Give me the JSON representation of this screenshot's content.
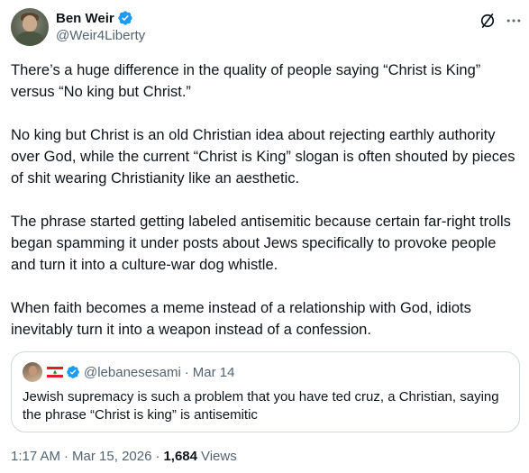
{
  "author": {
    "display_name": "Ben Weir",
    "handle": "@Weir4Liberty",
    "verified": true
  },
  "icons": {
    "verified": "verified-badge-icon",
    "grok": "grok-icon",
    "more": "more-options-icon",
    "flag": "lebanon-flag-icon"
  },
  "colors": {
    "verified_blue": "#1d9bf0",
    "secondary_text": "#536471",
    "border": "#cfd9de"
  },
  "tweet": {
    "paragraphs": [
      "There’s a huge difference in the quality of people saying “Christ is King” versus “No king but Christ.”",
      "No king but Christ is an old Christian idea about rejecting earthly authority over God, while the current “Christ is King” slogan is often shouted by pieces of shit wearing Christianity like an aesthetic.",
      "The phrase started getting labeled antisemitic because certain far-right trolls began spamming it under posts about Jews specifically to provoke people and turn it into a culture-war dog whistle.",
      "When faith becomes a meme instead of a relationship with God, idiots inevitably turn it into a weapon instead of a confession."
    ]
  },
  "quote": {
    "handle": "@lebanesesami",
    "separator": "·",
    "date": "Mar 14",
    "text": "Jewish supremacy is such a problem that you have ted cruz, a Christian, saying the phrase “Christ is king” is antisemitic"
  },
  "meta": {
    "time": "1:17 AM",
    "separator1": "·",
    "date": "Mar 15, 2026",
    "separator2": "·",
    "views_count": "1,684",
    "views_label": "Views"
  }
}
